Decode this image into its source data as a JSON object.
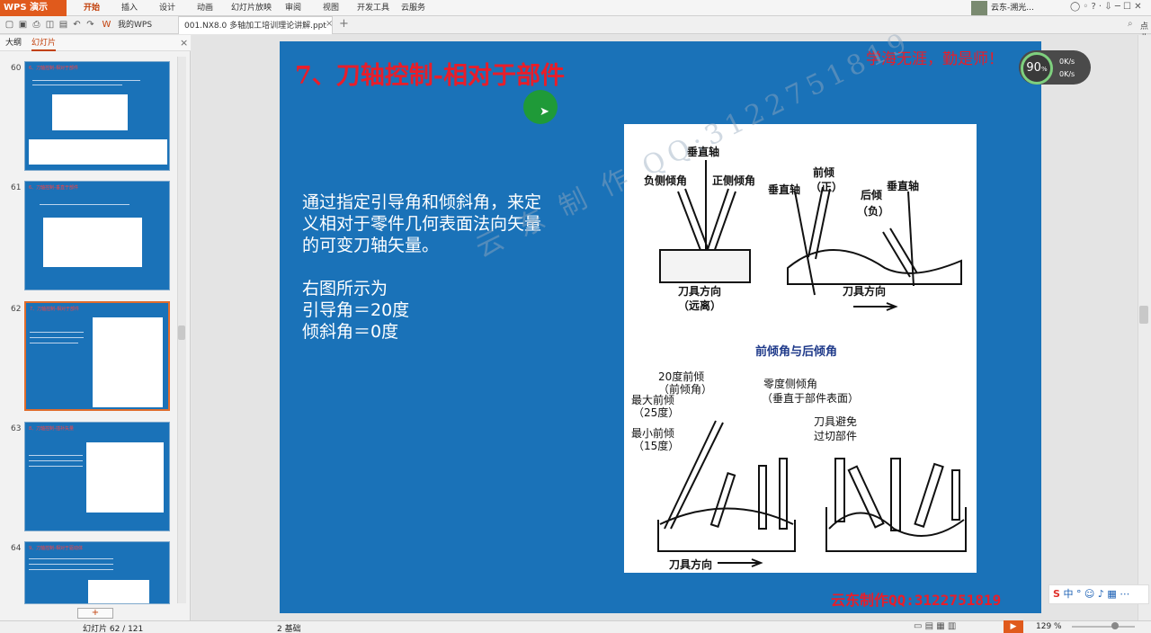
{
  "app": {
    "name": "WPS 演示",
    "menus": [
      "开始",
      "插入",
      "设计",
      "动画",
      "幻灯片放映",
      "审阅",
      "视图",
      "开发工具",
      "云服务"
    ],
    "active_menu": "开始",
    "user": "云东-溯光..."
  },
  "tabs": [
    {
      "label": "我的WPS"
    },
    {
      "label": "001.NX8.0 多轴加工培训理论讲解.ppt",
      "active": true
    }
  ],
  "search": {
    "label": "点此查"
  },
  "panel": {
    "tabs": [
      "大纲",
      "幻灯片"
    ],
    "active_tab": "幻灯片",
    "add_label": "+"
  },
  "thumbnails": [
    {
      "num": "60",
      "title": "6、刀轴控制-相对于部件"
    },
    {
      "num": "61",
      "title": "6、刀轴控制-垂直于部件"
    },
    {
      "num": "62",
      "title": "7、刀轴控制-相对于部件",
      "selected": true
    },
    {
      "num": "63",
      "title": "8、刀轴控制-插补矢量"
    },
    {
      "num": "64",
      "title": "9、刀轴控制-相对于驱动体"
    }
  ],
  "slide": {
    "title": "7、刀轴控制-相对于部件",
    "motto": "学海无涯，勤是师！",
    "body": [
      "通过指定引导角和倾斜角，来定",
      "义相对于零件几何表面法向矢量",
      "的可变刀轴矢量。",
      "右图所示为",
      "引导角＝20度",
      "倾斜角＝0度"
    ],
    "watermark": "云 东 制 作 QQ:3122751819",
    "credit": "云东制作QQ:3122751819"
  },
  "figure": {
    "labels": {
      "vertical_axis": "垂直轴",
      "neg_side_tilt": "负侧倾角",
      "pos_side_tilt": "正侧倾角",
      "lead_pos": "前倾",
      "lead_pos_sub": "（正）",
      "vertical_axis_2": "垂直轴",
      "lag": "后倾",
      "lag_sub": "（负）",
      "vertical_axis_3": "垂直轴",
      "tool_dir_1": "刀具方向",
      "tool_dir_1_sub": "（远离）",
      "tool_dir_2": "刀具方向",
      "caption": "前倾角与后倾角",
      "deg20": "20度前倾",
      "deg20_sub": "（前倾角）",
      "max_lead": "最大前倾",
      "max_lead_sub": "（25度）",
      "min_lead": "最小前倾",
      "min_lead_sub": "（15度）",
      "zero_side": "零度侧倾角",
      "zero_side_sub": "（垂直于部件表面）",
      "tool_avoid": "刀具避免",
      "tool_avoid_sub": "过切部件",
      "tool_dir_3": "刀具方向"
    }
  },
  "speed": {
    "percent": "90",
    "unit": "%",
    "up": "0K/s",
    "down": "0K/s"
  },
  "status": {
    "slide_pos": "幻灯片 62 / 121",
    "theme": "2 基础",
    "zoom": "129 %"
  },
  "ime": {
    "label": "中"
  }
}
